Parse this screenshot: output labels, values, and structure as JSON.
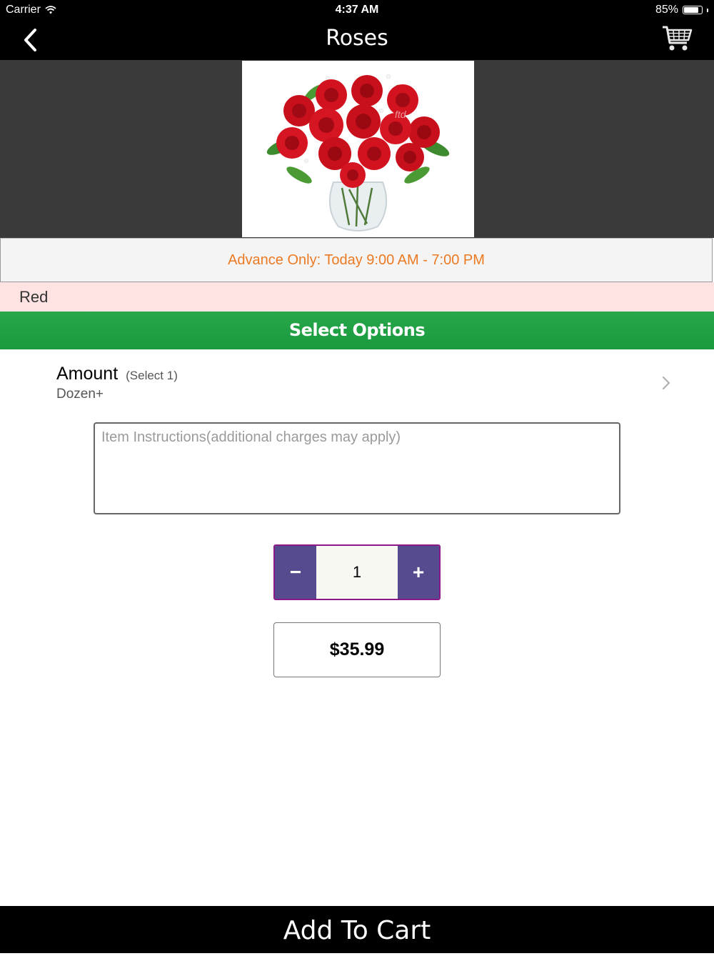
{
  "status_bar": {
    "carrier": "Carrier",
    "time": "4:37 AM",
    "battery": "85%",
    "battery_level": 0.85
  },
  "nav": {
    "title": "Roses",
    "back_icon": "chevron-left-icon",
    "cart_icon": "shopping-cart-icon"
  },
  "hero": {
    "image": "red-roses-bouquet-in-vase",
    "watermark": "ftd"
  },
  "availability": "Advance Only: Today 9:00 AM - 7:00 PM",
  "variant": "Red",
  "select_options_label": "Select Options",
  "amount": {
    "label": "Amount",
    "hint": "(Select 1)",
    "value": "Dozen+"
  },
  "instructions": {
    "placeholder": "Item Instructions(additional charges may apply)",
    "value": ""
  },
  "quantity": {
    "minus": "−",
    "value": "1",
    "plus": "+"
  },
  "price": "$35.99",
  "add_to_cart": "Add To Cart",
  "colors": {
    "availability_text": "#ec7a23",
    "variant_bg": "#ffe3e3",
    "options_bar": "#1fa145",
    "stepper": "#574b8f",
    "stepper_border": "#8a1a8a"
  }
}
